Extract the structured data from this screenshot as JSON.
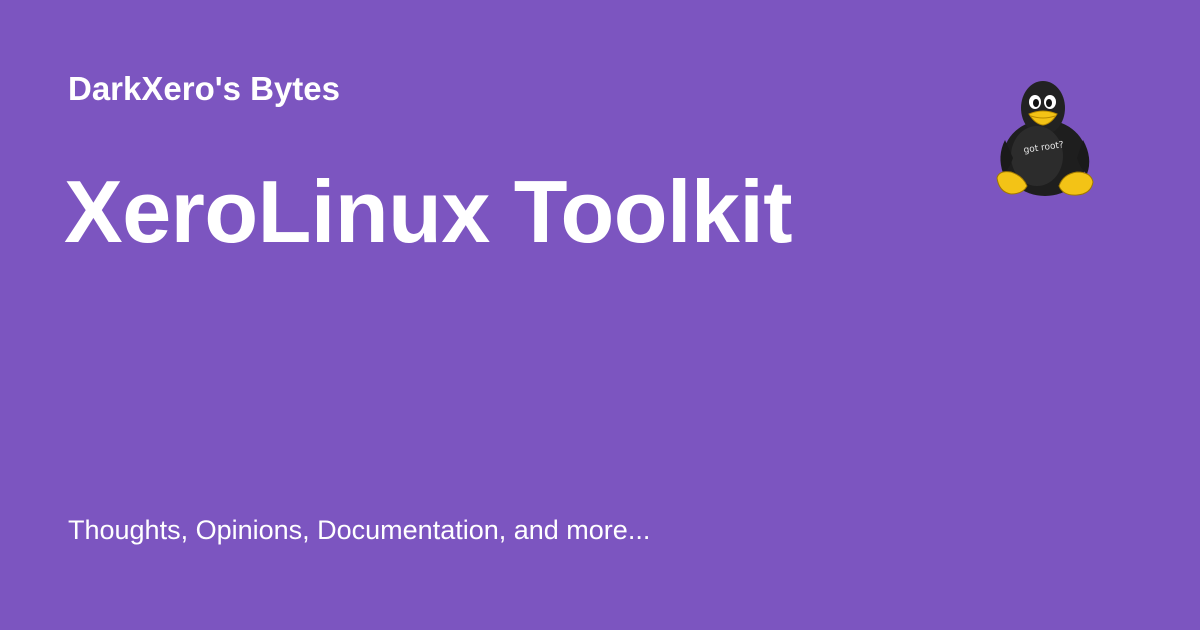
{
  "card": {
    "site_name": "DarkXero's Bytes",
    "title": "XeroLinux Toolkit",
    "tagline": "Thoughts, Opinions, Documentation, and more..."
  },
  "logo": {
    "icon": "tux-penguin-icon",
    "shirt_text": "got root?"
  },
  "colors": {
    "background": "#7c55c0",
    "text": "#ffffff"
  }
}
